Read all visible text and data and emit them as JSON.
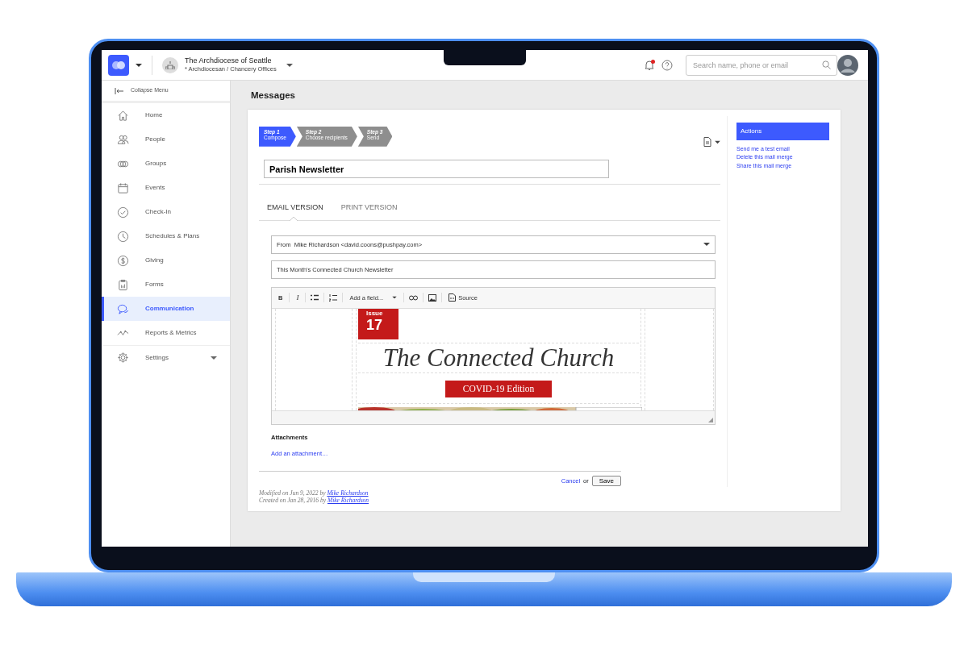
{
  "app_bar": {
    "org_name": "The Archdiocese of Seattle",
    "org_subtitle": "* Archdiocesan / Chancery Offices",
    "notification_unread": true,
    "search": {
      "placeholder": "Search name, phone or email"
    }
  },
  "sidebar": {
    "collapse_label": "Collapse Menu",
    "items": [
      {
        "label": "Home",
        "kind": "link",
        "selected": false
      },
      {
        "label": "People",
        "kind": "link",
        "selected": false
      },
      {
        "label": "Groups",
        "kind": "link",
        "selected": false
      },
      {
        "label": "Events",
        "kind": "link",
        "selected": false
      },
      {
        "label": "Check-In",
        "kind": "link",
        "selected": false
      },
      {
        "label": "Schedules & Plans",
        "kind": "link",
        "selected": false
      },
      {
        "label": "Giving",
        "kind": "link",
        "selected": false
      },
      {
        "label": "Forms",
        "kind": "link",
        "selected": false
      },
      {
        "label": "Communication",
        "kind": "link",
        "selected": true
      },
      {
        "label": "Reports & Metrics",
        "kind": "link",
        "selected": false
      },
      {
        "label": "Settings",
        "kind": "submenu",
        "selected": false
      }
    ]
  },
  "page_title": "Messages",
  "steps": [
    {
      "label": "Step 1",
      "text": "Compose",
      "selected": true
    },
    {
      "label": "Step 2",
      "text": "Choose recipients",
      "selected": false
    },
    {
      "label": "Step 3",
      "text": "Send",
      "selected": false
    }
  ],
  "name_field": {
    "value": "Parish Newsletter"
  },
  "tabs": [
    {
      "label": "EMAIL VERSION",
      "selected": true
    },
    {
      "label": "PRINT VERSION",
      "selected": false
    }
  ],
  "from_field": {
    "label": "From",
    "value": "Mike Richardson <david.coons@pushpay.com>"
  },
  "subject_field": {
    "value": "This Month's Connected Church Newsletter"
  },
  "toolbar": {
    "bold": "B",
    "italic": "I",
    "field_menu": "Add a field...",
    "source": "Source"
  },
  "newsletter": {
    "issue_label": "Issue",
    "issue_number": "17",
    "title": "The Connected Church",
    "edition": "COVID-19 Edition"
  },
  "attachments": {
    "title": "Attachments",
    "link": "Add an attachment…"
  },
  "form_actions": {
    "cancel": "Cancel",
    "or": "or",
    "save": "Save"
  },
  "history": [
    {
      "text": "Modified on Jun 9, 2022 by",
      "author": "Mike Richardson"
    },
    {
      "text": "Created on Jan 28, 2016 by",
      "author": "Mike Richardson"
    }
  ],
  "actions": {
    "title": "Actions",
    "links": [
      "Send me a test email",
      "Delete this mail merge",
      "Share this mail merge"
    ]
  }
}
